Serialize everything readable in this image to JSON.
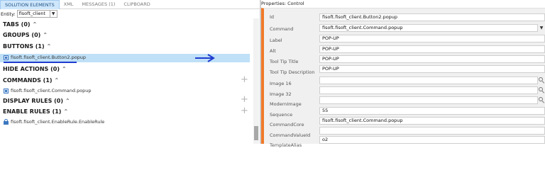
{
  "tabs": [
    "SOLUTION ELEMENTS",
    "XML",
    "MESSAGES (1)",
    "CLIPBOARD"
  ],
  "entity": {
    "label": "Entity:",
    "value": "fisoft_client"
  },
  "sections": [
    {
      "title": "TABS (0)",
      "caret": "⌃"
    },
    {
      "title": "GROUPS (0)",
      "caret": "⌃"
    },
    {
      "title": "BUTTONS (1)",
      "caret": "⌃"
    },
    {
      "title": "HIDE ACTIONS (0)",
      "caret": "⌃"
    },
    {
      "title": "COMMANDS (1)",
      "caret": "⌃"
    },
    {
      "title": "DISPLAY RULES (0)",
      "caret": "⌃"
    },
    {
      "title": "ENABLE RULES (1)",
      "caret": "⌃"
    }
  ],
  "items": {
    "button": "fisoft.fisoft_client.Button2.popup",
    "command": "fisoft.fisoft_client.Command.popup",
    "enable_rule": "fisoft.fisoft_client.EnableRule.EnableRule"
  },
  "properties": {
    "title": "Properties: Control",
    "rows": [
      {
        "label": "Id",
        "value": "fisoft.fisoft_client.Button2.popup"
      },
      {
        "label": "Command",
        "value": "fisoft.fisoft_client.Command.popup"
      },
      {
        "label": "Label",
        "value": "POP-UP"
      },
      {
        "label": "Alt",
        "value": "POP-UP"
      },
      {
        "label": "Tool Tip Title",
        "value": "POP-UP"
      },
      {
        "label": "Tool Tip Description",
        "value": "POP-UP"
      },
      {
        "label": "Image 16",
        "value": ""
      },
      {
        "label": "Image 32",
        "value": ""
      },
      {
        "label": "ModernImage",
        "value": ""
      },
      {
        "label": "Sequence",
        "value": "55"
      },
      {
        "label": "CommandCore",
        "value": "fisoft.fisoft_client.Command.popup"
      },
      {
        "label": "CommandValueId",
        "value": ""
      },
      {
        "label": "TemplateAlias",
        "value": "o2"
      }
    ]
  },
  "colors": {
    "accent": "#f07a2a",
    "selection": "#bfe0f7",
    "annotation": "#1f3ccf"
  },
  "icons": [
    "button-icon",
    "command-icon",
    "lock-icon",
    "plus-icon",
    "chevron-down-icon",
    "lookup-icon",
    "arrow-right-icon"
  ]
}
